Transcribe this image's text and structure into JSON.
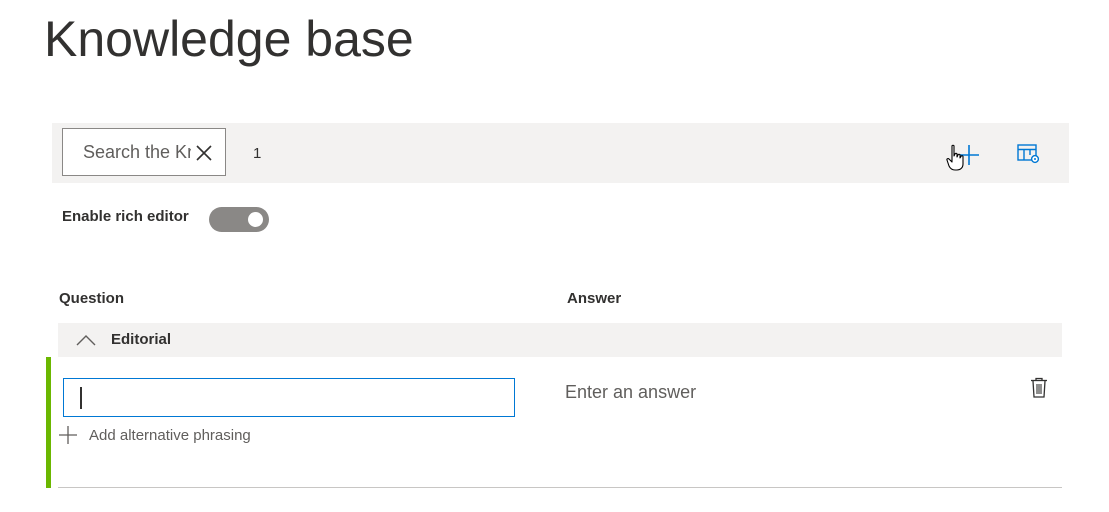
{
  "page": {
    "title": "Knowledge base"
  },
  "toolbar": {
    "search": {
      "placeholder": "Search the Knowledge base",
      "value": ""
    },
    "result_count": "1",
    "add_icon": "add-icon",
    "settings_icon": "view-options-icon"
  },
  "rich_editor": {
    "label": "Enable rich editor",
    "enabled": true
  },
  "table": {
    "columns": {
      "question": "Question",
      "answer": "Answer"
    },
    "groups": [
      {
        "label": "Editorial",
        "expanded": true,
        "rows": [
          {
            "question_value": "",
            "add_phrasing_label": "Add alternative phrasing",
            "answer_placeholder": "Enter an answer"
          }
        ]
      }
    ]
  },
  "colors": {
    "accent": "#0078d4",
    "row_accent": "#6bb700",
    "toolbar_bg": "#f3f2f1",
    "toggle_bg": "#8a8886"
  }
}
